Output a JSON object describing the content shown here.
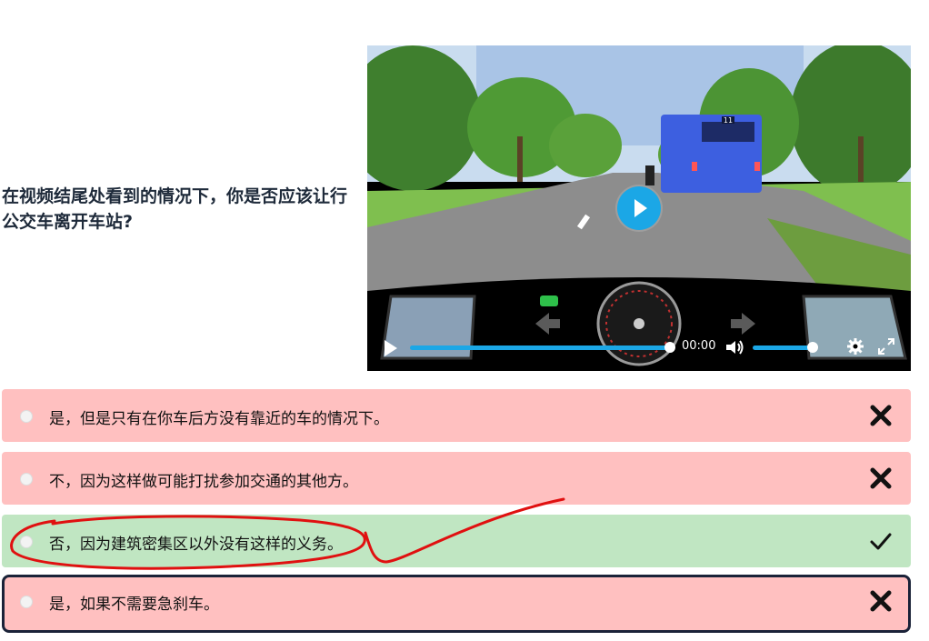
{
  "question": {
    "text": "在视频结尾处看到的情况下，你是否应该让行公交车离开车站?"
  },
  "video": {
    "time": "00:00",
    "progress": 1.0,
    "volume": 1.0,
    "bus_number": "11",
    "colors": {
      "accent": "#1ba7e6"
    }
  },
  "answers": [
    {
      "text": "是，但是只有在你车后方没有靠近的车的情况下。",
      "status": "wrong",
      "mark": "cross-icon"
    },
    {
      "text": "不，因为这样做可能打扰参加交通的其他方。",
      "status": "wrong",
      "mark": "cross-icon"
    },
    {
      "text": "否，因为建筑密集区以外没有这样的义务。",
      "status": "correct",
      "mark": "check-icon"
    },
    {
      "text": "是，如果不需要急刹车。",
      "status": "wrong",
      "mark": "cross-icon",
      "selected": true
    }
  ],
  "colors": {
    "wrong_bg": "#ffc0c0",
    "correct_bg": "#c0e6c2",
    "selected_border": "#1a2238",
    "annotation": "#e01010"
  }
}
